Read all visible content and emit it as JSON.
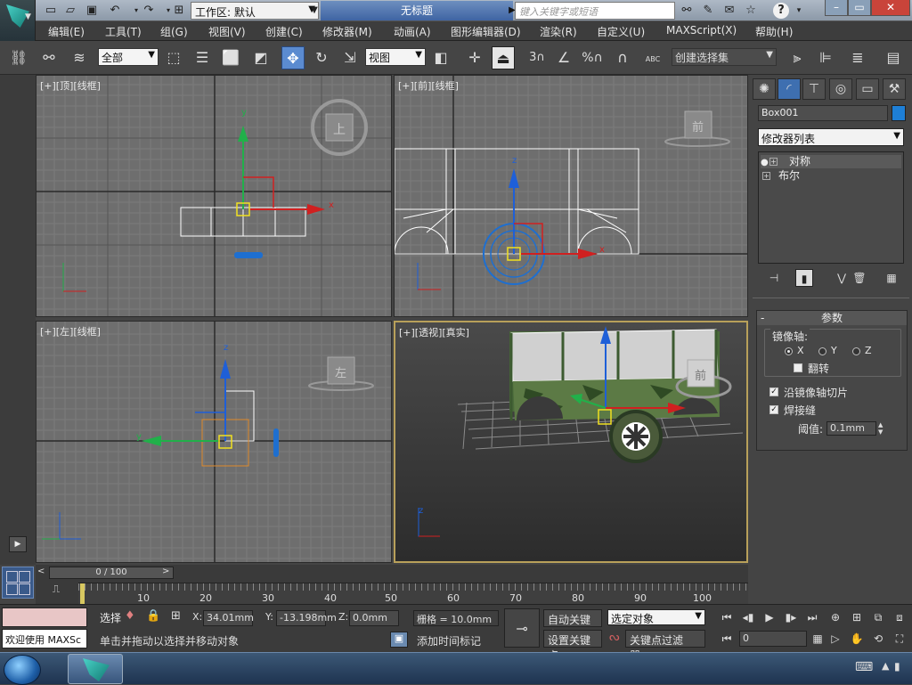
{
  "app": {
    "title": "无标题",
    "workspace_label": "工作区: 默认",
    "search_placeholder": "键入关键字或短语"
  },
  "menu": [
    "编辑(E)",
    "工具(T)",
    "组(G)",
    "视图(V)",
    "创建(C)",
    "修改器(M)",
    "动画(A)",
    "图形编辑器(D)",
    "渲染(R)",
    "自定义(U)",
    "MAXScript(X)",
    "帮助(H)"
  ],
  "toolbar": {
    "selection_filter": "全部",
    "reference_coord": "视图",
    "named_selection": "创建选择集",
    "snap_3": "3",
    "percent": "%",
    "abc": "ABC"
  },
  "viewports": [
    {
      "label": "[+][顶][线框]",
      "cube_label": "上"
    },
    {
      "label": "[+][前][线框]",
      "cube_label": "前"
    },
    {
      "label": "[+][左][线框]",
      "cube_label": "左"
    },
    {
      "label": "[+][透视][真实]",
      "cube_label": "前"
    }
  ],
  "axes": {
    "x": "x",
    "y": "y",
    "z": "z"
  },
  "command_panel": {
    "object_name": "Box001",
    "object_color": "#1e7fd6",
    "modifier_list": "修改器列表",
    "stack": [
      {
        "name": "对称",
        "expanded": true,
        "selected": true
      },
      {
        "name": "布尔",
        "expanded": true,
        "selected": false
      }
    ],
    "params_title": "参数",
    "mirror_axis_label": "镜像轴:",
    "axes": [
      "X",
      "Y",
      "Z"
    ],
    "selected_axis": "X",
    "flip_label": "翻转",
    "slice_label": "沿镜像轴切片",
    "slice_checked": true,
    "weld_label": "焊接缝",
    "weld_checked": true,
    "threshold_label": "阈值:",
    "threshold_value": "0.1mm"
  },
  "timeline": {
    "slider_text": "0 / 100",
    "ticks": [
      "10",
      "20",
      "30",
      "40",
      "50",
      "60",
      "70",
      "80",
      "90",
      "100"
    ]
  },
  "status": {
    "maxscript_text": "欢迎使用 MAXSc",
    "selection_text": "选择",
    "prompt": "单击并拖动以选择并移动对象",
    "x_label": "X:",
    "x_value": "34.01mm",
    "y_label": "Y:",
    "y_value": "-13.198mm",
    "z_label": "Z:",
    "z_value": "0.0mm",
    "grid": "栅格 = 10.0mm",
    "add_time_tag": "添加时间标记",
    "auto_key": "自动关键点",
    "set_key": "设置关键点",
    "key_filter_select": "选定对象",
    "key_filters": "关键点过滤器...",
    "frame": "0"
  }
}
